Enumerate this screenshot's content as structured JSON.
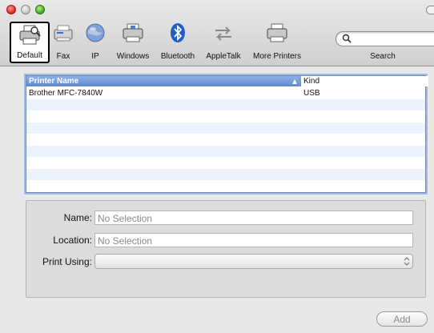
{
  "toolbar": {
    "items": [
      {
        "label": "Default",
        "icon": "default-printer-icon",
        "selected": true
      },
      {
        "label": "Fax",
        "icon": "fax-icon"
      },
      {
        "label": "IP",
        "icon": "globe-icon"
      },
      {
        "label": "Windows",
        "icon": "windows-printer-icon"
      },
      {
        "label": "Bluetooth",
        "icon": "bluetooth-icon"
      },
      {
        "label": "AppleTalk",
        "icon": "appletalk-icon"
      },
      {
        "label": "More Printers",
        "icon": "more-printers-icon"
      }
    ],
    "search_label": "Search",
    "search_value": ""
  },
  "list": {
    "columns": [
      "Printer Name",
      "Kind"
    ],
    "rows": [
      {
        "name": "Brother MFC-7840W",
        "kind": "USB"
      }
    ]
  },
  "details": {
    "name_label": "Name:",
    "name_placeholder": "No Selection",
    "location_label": "Location:",
    "location_placeholder": "No Selection",
    "print_using_label": "Print Using:",
    "print_using_value": ""
  },
  "add_button": "Add",
  "colors": {
    "header_blue": "#5d88d2",
    "stripe": "#edf3fe",
    "selection_border": "#000000"
  }
}
